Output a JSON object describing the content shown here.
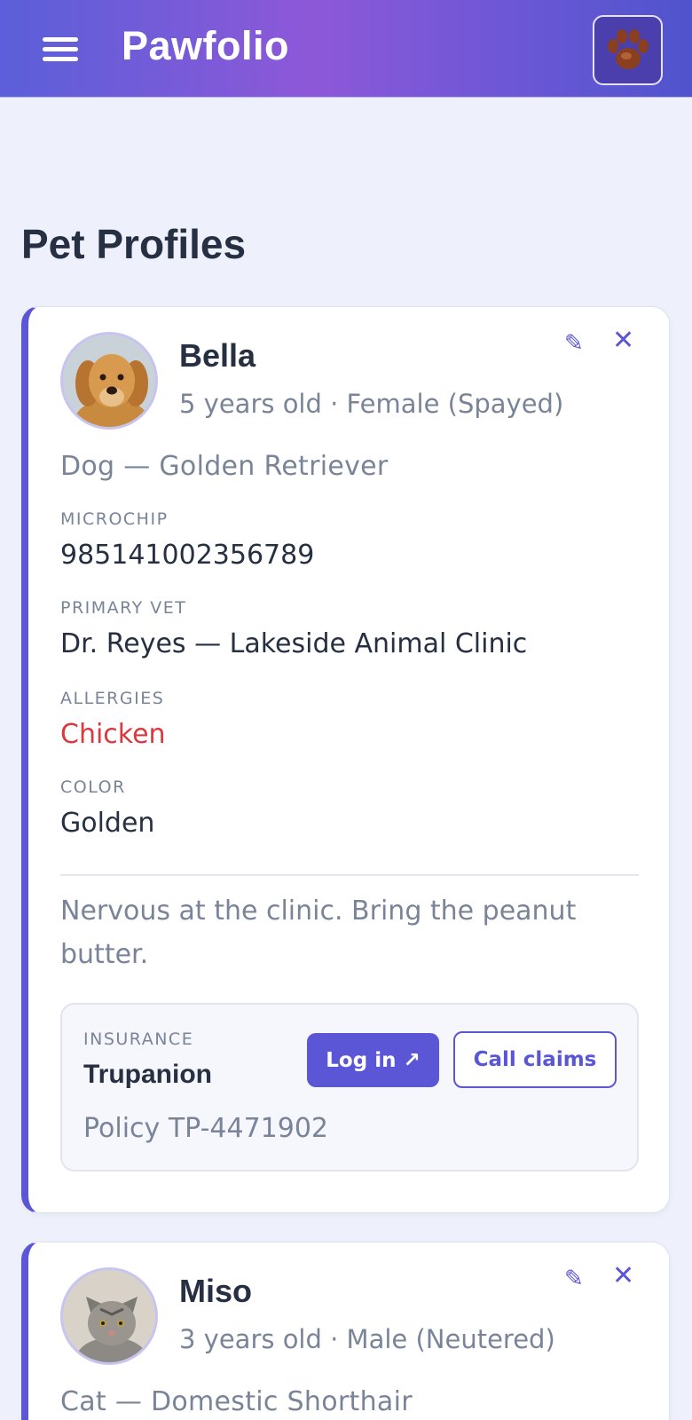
{
  "app": {
    "title": "Pawfolio",
    "menu_icon": "hamburger-icon",
    "profile_icon": "paw-icon"
  },
  "page": {
    "title": "Pet Profiles"
  },
  "colors": {
    "accent": "#5b56d6",
    "alert": "#d9393e",
    "muted": "#7a8499",
    "text": "#263042"
  },
  "pets": [
    {
      "name": "Bella",
      "meta": "5 years old · Female (Spayed)",
      "species": "Dog — Golden Retriever",
      "photo_icon": "golden-retriever-photo",
      "edit_icon": "✎",
      "remove_icon": "✕",
      "fields": [
        {
          "label": "MICROCHIP",
          "value": "985141002356789"
        },
        {
          "label": "PRIMARY VET",
          "value": "Dr. Reyes — Lakeside Animal Clinic"
        },
        {
          "label": "ALLERGIES",
          "value": "Chicken"
        },
        {
          "label": "COLOR",
          "value": "Golden"
        }
      ],
      "note": "Nervous at the clinic. Bring the peanut butter.",
      "insurance": {
        "label": "INSURANCE",
        "provider": "Trupanion",
        "policy": "Policy TP-4471902",
        "login_label": "Log in ↗",
        "claims_label": "Call claims"
      }
    },
    {
      "name": "Miso",
      "meta": "3 years old · Male (Neutered)",
      "species": "Cat — Domestic Shorthair",
      "photo_icon": "tabby-cat-photo",
      "edit_icon": "✎",
      "remove_icon": "✕"
    }
  ]
}
